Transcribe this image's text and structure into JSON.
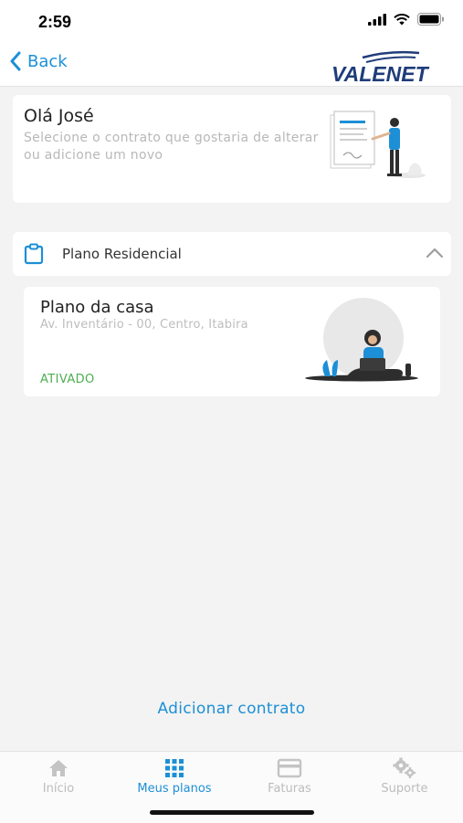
{
  "status": {
    "time": "2:59"
  },
  "nav": {
    "back_label": "Back",
    "logo_text": "VALENET"
  },
  "greeting": {
    "title": "Olá José",
    "subtitle": "Selecione o contrato que gostaria de alterar ou adicione um novo"
  },
  "section": {
    "title": "Plano Residencial"
  },
  "plan": {
    "title": "Plano da casa",
    "address": "Av. Inventário - 00, Centro, Itabira",
    "status": "ATIVADO"
  },
  "add_contract_label": "Adicionar contrato",
  "tabs": [
    {
      "label": "Início",
      "icon": "home-icon",
      "active": false
    },
    {
      "label": "Meus planos",
      "icon": "grid-icon",
      "active": true
    },
    {
      "label": "Faturas",
      "icon": "credit-card-icon",
      "active": false
    },
    {
      "label": "Suporte",
      "icon": "gears-icon",
      "active": false
    }
  ],
  "colors": {
    "accent": "#1d8fd6",
    "active_status": "#4caf50",
    "logo": "#1f3d7a"
  }
}
